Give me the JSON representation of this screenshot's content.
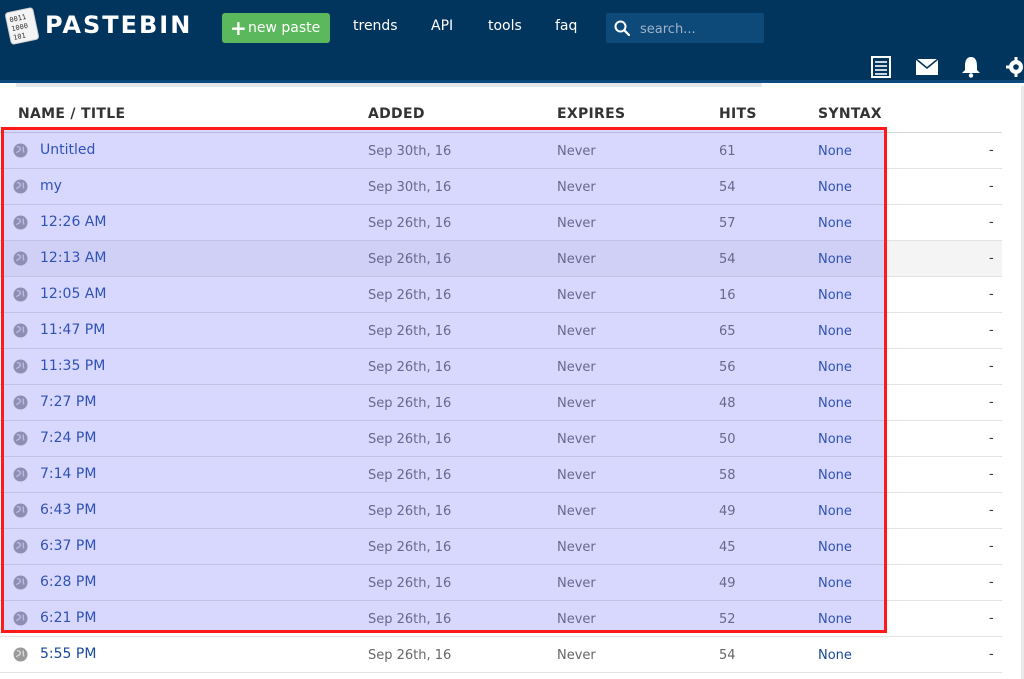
{
  "header": {
    "logo_text": "PASTEBIN",
    "logo_digits": [
      "0011",
      "1000",
      "101"
    ],
    "new_paste_label": "new paste",
    "nav": [
      "trends",
      "API",
      "tools",
      "faq"
    ],
    "search_placeholder": "search..."
  },
  "colors": {
    "header_bg": "#02355e",
    "new_paste_green": "#5cb85c",
    "link_blue": "#18489a",
    "selection_border": "#ff1a1a",
    "selection_fill": "rgba(110,110,255,0.27)"
  },
  "icons": [
    "logo-icon",
    "plus-icon",
    "search-icon",
    "list-icon",
    "mail-icon",
    "bell-icon",
    "gear-icon",
    "globe-icon"
  ],
  "table": {
    "columns": [
      "NAME / TITLE",
      "ADDED",
      "EXPIRES",
      "HITS",
      "SYNTAX"
    ],
    "rows": [
      {
        "title": "Untitled",
        "added": "Sep 30th, 16",
        "expires": "Never",
        "hits": "61",
        "syntax": "None",
        "extra": "-"
      },
      {
        "title": "my",
        "added": "Sep 30th, 16",
        "expires": "Never",
        "hits": "54",
        "syntax": "None",
        "extra": "-"
      },
      {
        "title": "12:26 AM",
        "added": "Sep 26th, 16",
        "expires": "Never",
        "hits": "57",
        "syntax": "None",
        "extra": "-"
      },
      {
        "title": "12:13 AM",
        "added": "Sep 26th, 16",
        "expires": "Never",
        "hits": "54",
        "syntax": "None",
        "extra": "-"
      },
      {
        "title": "12:05 AM",
        "added": "Sep 26th, 16",
        "expires": "Never",
        "hits": "16",
        "syntax": "None",
        "extra": "-"
      },
      {
        "title": "11:47 PM",
        "added": "Sep 26th, 16",
        "expires": "Never",
        "hits": "65",
        "syntax": "None",
        "extra": "-"
      },
      {
        "title": "11:35 PM",
        "added": "Sep 26th, 16",
        "expires": "Never",
        "hits": "56",
        "syntax": "None",
        "extra": "-"
      },
      {
        "title": "7:27 PM",
        "added": "Sep 26th, 16",
        "expires": "Never",
        "hits": "48",
        "syntax": "None",
        "extra": "-"
      },
      {
        "title": "7:24 PM",
        "added": "Sep 26th, 16",
        "expires": "Never",
        "hits": "50",
        "syntax": "None",
        "extra": "-"
      },
      {
        "title": "7:14 PM",
        "added": "Sep 26th, 16",
        "expires": "Never",
        "hits": "58",
        "syntax": "None",
        "extra": "-"
      },
      {
        "title": "6:43 PM",
        "added": "Sep 26th, 16",
        "expires": "Never",
        "hits": "49",
        "syntax": "None",
        "extra": "-"
      },
      {
        "title": "6:37 PM",
        "added": "Sep 26th, 16",
        "expires": "Never",
        "hits": "45",
        "syntax": "None",
        "extra": "-"
      },
      {
        "title": "6:28 PM",
        "added": "Sep 26th, 16",
        "expires": "Never",
        "hits": "49",
        "syntax": "None",
        "extra": "-"
      },
      {
        "title": "6:21 PM",
        "added": "Sep 26th, 16",
        "expires": "Never",
        "hits": "52",
        "syntax": "None",
        "extra": "-"
      },
      {
        "title": "5:55 PM",
        "added": "Sep 26th, 16",
        "expires": "Never",
        "hits": "54",
        "syntax": "None",
        "extra": "-"
      }
    ]
  }
}
